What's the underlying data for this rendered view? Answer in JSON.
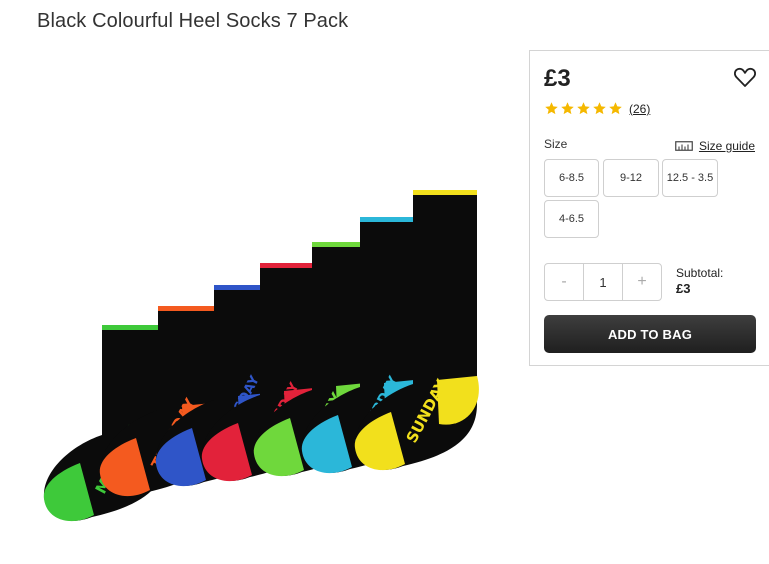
{
  "product": {
    "title": "Black Colourful Heel Socks 7 Pack",
    "price": "£3",
    "rating": {
      "stars": 5,
      "max": 5,
      "review_count": "(26)"
    },
    "size": {
      "label": "Size",
      "guide_label": "Size guide",
      "options": [
        "6-8.5",
        "9-12",
        "12.5 - 3.5",
        "4-6.5"
      ]
    },
    "quantity": {
      "minus": "-",
      "value": "1",
      "plus": "+"
    },
    "subtotal": {
      "label": "Subtotal:",
      "amount": "£3"
    },
    "add_to_bag": "ADD TO BAG"
  },
  "socks": [
    {
      "day": "MONDAY",
      "accent": "#3ec93a"
    },
    {
      "day": "TUESDAY",
      "accent": "#f45a1f"
    },
    {
      "day": "WEDNESDAY",
      "accent": "#2f55c8"
    },
    {
      "day": "THURSDAY",
      "accent": "#e2223a"
    },
    {
      "day": "FRIDAY",
      "accent": "#6fd83c"
    },
    {
      "day": "SATURDAY",
      "accent": "#2bb7d9"
    },
    {
      "day": "SUNDAY",
      "accent": "#f2e01c"
    }
  ],
  "colors": {
    "star": "#f5b800",
    "button": "#2b2b2b"
  },
  "icons": {
    "wishlist": "heart-outline-icon",
    "size_guide": "ruler-icon",
    "rating": "star-icon"
  }
}
